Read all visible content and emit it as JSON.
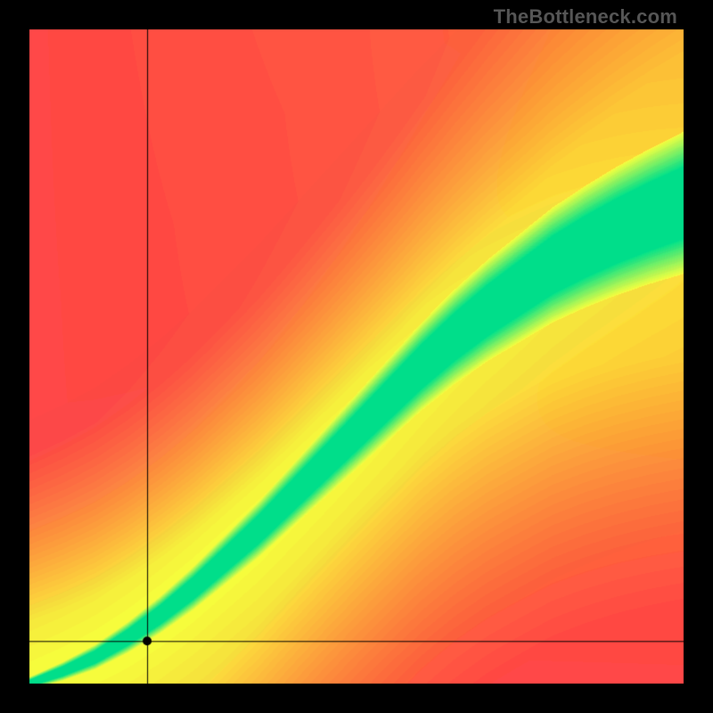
{
  "watermark": "TheBottleneck.com",
  "canvas": {
    "size": 800,
    "inset": 33
  },
  "marker": {
    "x_frac": 0.18,
    "y_frac": 0.935,
    "radius": 5
  },
  "crosshair": {
    "color": "#000000",
    "width": 1
  },
  "chart_data": {
    "type": "heatmap",
    "title": "",
    "xlabel": "",
    "ylabel": "",
    "xlim": [
      0,
      1
    ],
    "ylim": [
      0,
      1
    ],
    "colors": {
      "optimal": "#00e08a",
      "near": "#f6ff3f",
      "warm": "#ff9a2e",
      "bad": "#ff2a4d"
    },
    "optimal_curve": {
      "description": "green ridge y = f(x), approximated from pixels",
      "x": [
        0.0,
        0.05,
        0.1,
        0.15,
        0.2,
        0.25,
        0.3,
        0.35,
        0.4,
        0.45,
        0.5,
        0.55,
        0.6,
        0.65,
        0.7,
        0.75,
        0.8,
        0.85,
        0.9,
        0.95,
        1.0
      ],
      "y": [
        0.0,
        0.018,
        0.04,
        0.07,
        0.105,
        0.145,
        0.19,
        0.235,
        0.285,
        0.335,
        0.385,
        0.435,
        0.485,
        0.53,
        0.57,
        0.605,
        0.64,
        0.668,
        0.693,
        0.715,
        0.735
      ]
    },
    "band_halfwidth": {
      "x": [
        0.0,
        0.2,
        0.4,
        0.6,
        0.8,
        1.0
      ],
      "h": [
        0.006,
        0.018,
        0.03,
        0.042,
        0.055,
        0.068
      ]
    },
    "marker_point": {
      "x": 0.18,
      "y": 0.065
    }
  }
}
